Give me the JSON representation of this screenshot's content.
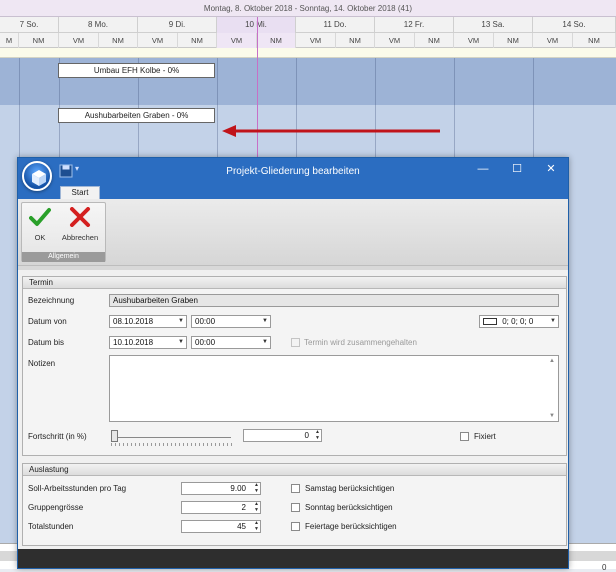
{
  "scheduler": {
    "week_header": "Montag, 8. Oktober 2018 - Sonntag, 14. Oktober 2018 (41)",
    "days": [
      "7 So.",
      "8 Mo.",
      "9 Di.",
      "10 Mi.",
      "11 Do.",
      "12 Fr.",
      "13 Sa.",
      "14 So."
    ],
    "halves": [
      "M",
      "NM",
      "VM",
      "NM",
      "VM",
      "NM",
      "VM",
      "NM",
      "VM",
      "NM",
      "VM",
      "NM",
      "VM",
      "NM",
      "VM",
      "NM"
    ],
    "task_1": "Umbau EFH Kolbe - 0%",
    "task_2": "Aushubarbeiten Graben - 0%",
    "corner_number": "0",
    "arrow_color": "#c0141a"
  },
  "dialog": {
    "title": "Projekt-Gliederung bearbeiten",
    "tab": "Start",
    "ribbon": {
      "ok_label": "OK",
      "cancel_label": "Abbrechen",
      "group_label": "Allgemein"
    },
    "termin": {
      "header": "Termin",
      "bezeichnung_label": "Bezeichnung",
      "bezeichnung_value": "Aushubarbeiten Graben",
      "datum_von_label": "Datum von",
      "datum_von_value": "08.10.2018",
      "zeit_von_value": "00:00",
      "datum_bis_label": "Datum bis",
      "datum_bis_value": "10.10.2018",
      "zeit_bis_value": "00:00",
      "color_value": "0; 0; 0; 0",
      "termin_zusammen_label": "Termin wird zusammengehalten",
      "notizen_label": "Notizen",
      "fortschritt_label": "Fortschritt (in %)",
      "fortschritt_value": "0",
      "fixiert_label": "Fixiert"
    },
    "auslastung": {
      "header": "Auslastung",
      "soll_label": "Soll-Arbeitsstunden pro Tag",
      "soll_value": "9.00",
      "gruppe_label": "Gruppengrösse",
      "gruppe_value": "2",
      "total_label": "Totalstunden",
      "total_value": "45",
      "samstag_label": "Samstag berücksichtigen",
      "sonntag_label": "Sonntag berücksichtigen",
      "feiertage_label": "Feiertage berücksichtigen"
    },
    "accent_color": "#2b6dc1"
  }
}
